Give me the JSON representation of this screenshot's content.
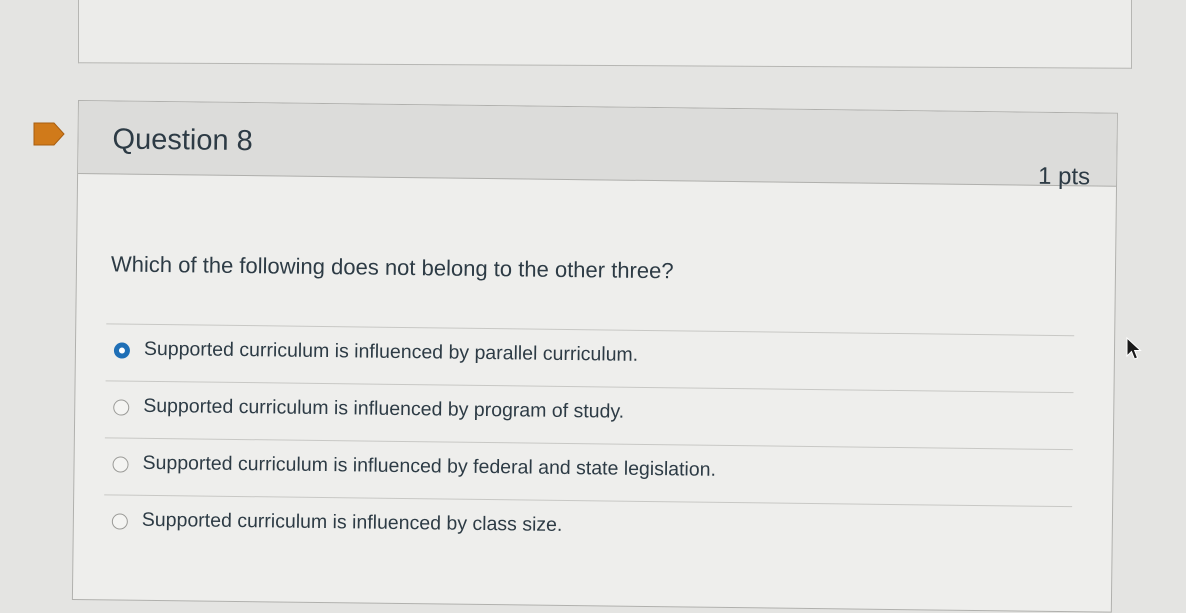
{
  "question": {
    "title": "Question 8",
    "points": "1 pts",
    "text": "Which of the following does not belong to the other three?",
    "flag_icon": "flag-icon",
    "answers": [
      {
        "label": "Supported curriculum is influenced by parallel curriculum.",
        "selected": true
      },
      {
        "label": "Supported curriculum is influenced by program of study.",
        "selected": false
      },
      {
        "label": "Supported curriculum is influenced by federal and state legislation.",
        "selected": false
      },
      {
        "label": "Supported curriculum is influenced by class size.",
        "selected": false
      }
    ]
  },
  "colors": {
    "flag": "#d07a1a",
    "selected_radio": "#1f6fb6",
    "text": "#2d3b45",
    "header_bg": "#dcdcda"
  }
}
